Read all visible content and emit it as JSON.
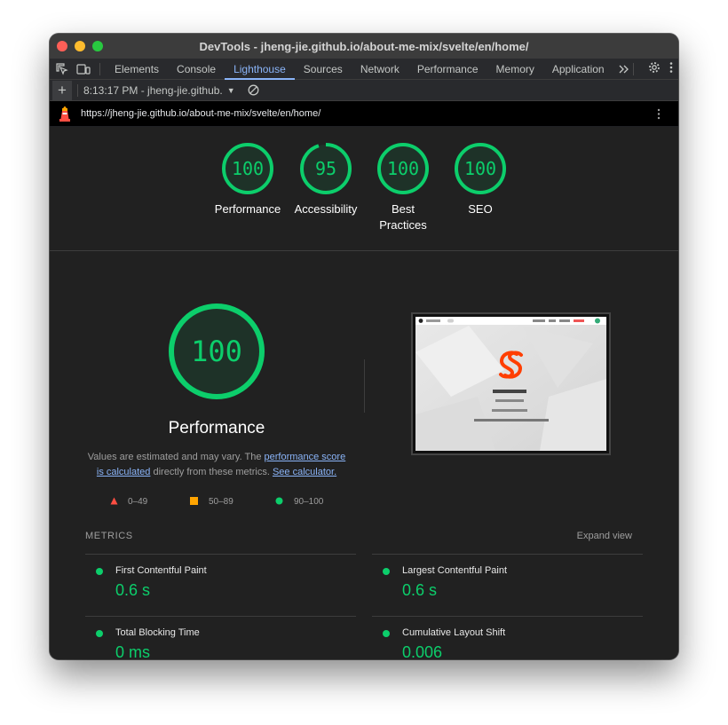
{
  "window": {
    "title": "DevTools - jheng-jie.github.io/about-me-mix/svelte/en/home/"
  },
  "devtools_tabs": [
    {
      "label": "Elements"
    },
    {
      "label": "Console"
    },
    {
      "label": "Lighthouse"
    },
    {
      "label": "Sources"
    },
    {
      "label": "Network"
    },
    {
      "label": "Performance"
    },
    {
      "label": "Memory"
    },
    {
      "label": "Application"
    }
  ],
  "report_toolbar": {
    "report_label": "8:13:17 PM - jheng-jie.github."
  },
  "url_bar": {
    "url": "https://jheng-jie.github.io/about-me-mix/svelte/en/home/"
  },
  "scores": [
    {
      "value": "100",
      "score": 100,
      "label": "Performance"
    },
    {
      "value": "95",
      "score": 95,
      "label": "Accessibility"
    },
    {
      "value": "100",
      "score": 100,
      "label": "Best Practices"
    },
    {
      "value": "100",
      "score": 100,
      "label": "SEO"
    }
  ],
  "performance": {
    "score": "100",
    "title": "Performance",
    "desc_prefix": "Values are estimated and may vary. The ",
    "desc_link1": "performance score is calculated",
    "desc_mid": " directly from these metrics. ",
    "desc_link2": "See calculator."
  },
  "legend": {
    "fail": "0–49",
    "average": "50–89",
    "pass": "90–100"
  },
  "metrics": {
    "header": "METRICS",
    "expand": "Expand view",
    "items": [
      {
        "label": "First Contentful Paint",
        "value": "0.6 s"
      },
      {
        "label": "Largest Contentful Paint",
        "value": "0.6 s"
      },
      {
        "label": "Total Blocking Time",
        "value": "0 ms"
      },
      {
        "label": "Cumulative Layout Shift",
        "value": "0.006"
      }
    ]
  },
  "colors": {
    "pass": "#0cce6b",
    "average": "#ffa400",
    "fail": "#ff4e42",
    "accent": "#8ab4f8"
  }
}
